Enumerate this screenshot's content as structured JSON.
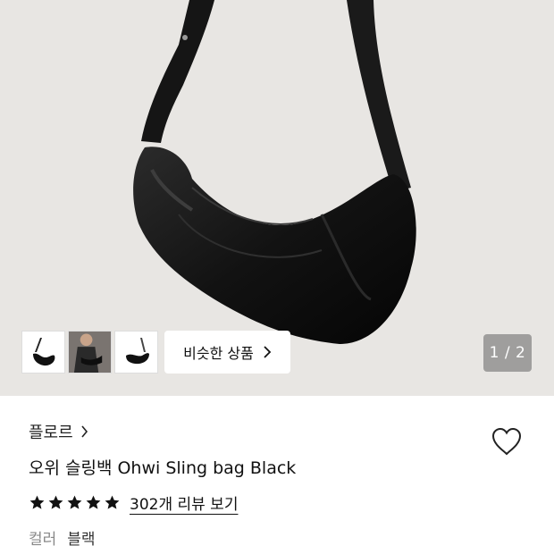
{
  "gallery": {
    "similar_label": "비슷한 상품",
    "pager": "1 / 2",
    "thumbnails": [
      "bag-front",
      "model-wearing",
      "bag-side"
    ]
  },
  "product": {
    "brand": "플로르",
    "title": "오위 슬링백 Ohwi Sling bag Black",
    "rating": 5,
    "review_link": "302개 리뷰 보기",
    "color_label": "컬러",
    "color_value": "블랙"
  }
}
